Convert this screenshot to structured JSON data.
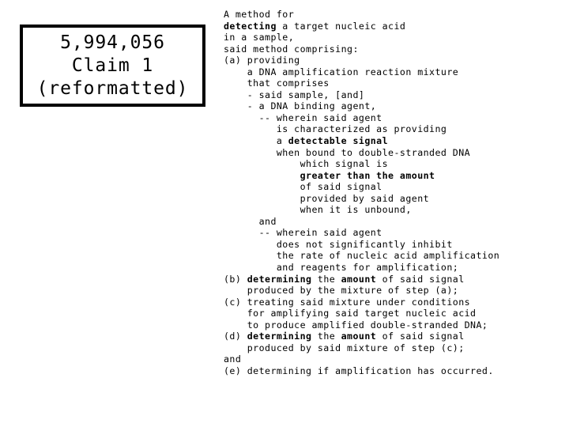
{
  "title_box": {
    "lines": [
      "5,994,056",
      "Claim 1",
      "(reformatted)"
    ],
    "border_color": "#000000",
    "text_color": "#000000"
  },
  "claim": {
    "lines": [
      [
        {
          "t": "A method for",
          "b": false
        }
      ],
      [
        {
          "t": "detecting",
          "b": true
        },
        {
          "t": " a target nucleic acid",
          "b": false
        }
      ],
      [
        {
          "t": "in a sample,",
          "b": false
        }
      ],
      [
        {
          "t": "said method comprising:",
          "b": false
        }
      ],
      [
        {
          "t": "(a) providing",
          "b": false
        }
      ],
      [
        {
          "t": "    a DNA amplification reaction mixture",
          "b": false
        }
      ],
      [
        {
          "t": "    that comprises",
          "b": false
        }
      ],
      [
        {
          "t": "    - said sample, [and]",
          "b": false
        }
      ],
      [
        {
          "t": "    - a DNA binding agent,",
          "b": false
        }
      ],
      [
        {
          "t": "      -- wherein said agent",
          "b": false
        }
      ],
      [
        {
          "t": "         is characterized as providing",
          "b": false
        }
      ],
      [
        {
          "t": "         a ",
          "b": false
        },
        {
          "t": "detectable signal",
          "b": true
        }
      ],
      [
        {
          "t": "         when bound to double-stranded DNA",
          "b": false
        }
      ],
      [
        {
          "t": "             which signal is",
          "b": false
        }
      ],
      [
        {
          "t": "             ",
          "b": false
        },
        {
          "t": "greater than the amount",
          "b": true
        }
      ],
      [
        {
          "t": "             of said signal",
          "b": false
        }
      ],
      [
        {
          "t": "             provided by said agent",
          "b": false
        }
      ],
      [
        {
          "t": "             when it is unbound,",
          "b": false
        }
      ],
      [
        {
          "t": "      and",
          "b": false
        }
      ],
      [
        {
          "t": "      -- wherein said agent",
          "b": false
        }
      ],
      [
        {
          "t": "         does not significantly inhibit",
          "b": false
        }
      ],
      [
        {
          "t": "         the rate of nucleic acid amplification",
          "b": false
        }
      ],
      [
        {
          "t": "         and reagents for amplification;",
          "b": false
        }
      ],
      [
        {
          "t": "(b) ",
          "b": false
        },
        {
          "t": "determining",
          "b": true
        },
        {
          "t": " the ",
          "b": false
        },
        {
          "t": "amount",
          "b": true
        },
        {
          "t": " of said signal",
          "b": false
        }
      ],
      [
        {
          "t": "    produced by the mixture of step (a);",
          "b": false
        }
      ],
      [
        {
          "t": "(c) treating said mixture under conditions",
          "b": false
        }
      ],
      [
        {
          "t": "    for amplifying said target nucleic acid",
          "b": false
        }
      ],
      [
        {
          "t": "    to produce amplified double-stranded DNA;",
          "b": false
        }
      ],
      [
        {
          "t": "(d) ",
          "b": false
        },
        {
          "t": "determining",
          "b": true
        },
        {
          "t": " the ",
          "b": false
        },
        {
          "t": "amount",
          "b": true
        },
        {
          "t": " of said signal",
          "b": false
        }
      ],
      [
        {
          "t": "    produced by said mixture of step (c);",
          "b": false
        }
      ],
      [
        {
          "t": "and",
          "b": false
        }
      ],
      [
        {
          "t": "(e) determining if amplification has occurred.",
          "b": false
        }
      ]
    ]
  }
}
